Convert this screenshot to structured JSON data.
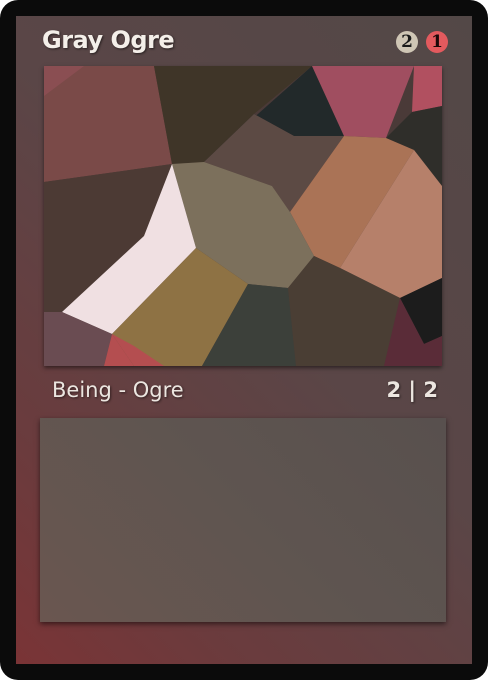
{
  "card": {
    "name": "Gray Ogre",
    "mana_cost": {
      "generic": "2",
      "red": "1",
      "generic_color": "#cfc6b5",
      "red_color": "#e35a5e"
    },
    "type_line": "Being - Ogre",
    "power_toughness": "2 | 2",
    "rules_text": "",
    "colors": {
      "border": "#0b0b0b",
      "frame_top": "#534847",
      "frame_bottom": "#7a3436",
      "text_box": "#5f5550"
    }
  }
}
